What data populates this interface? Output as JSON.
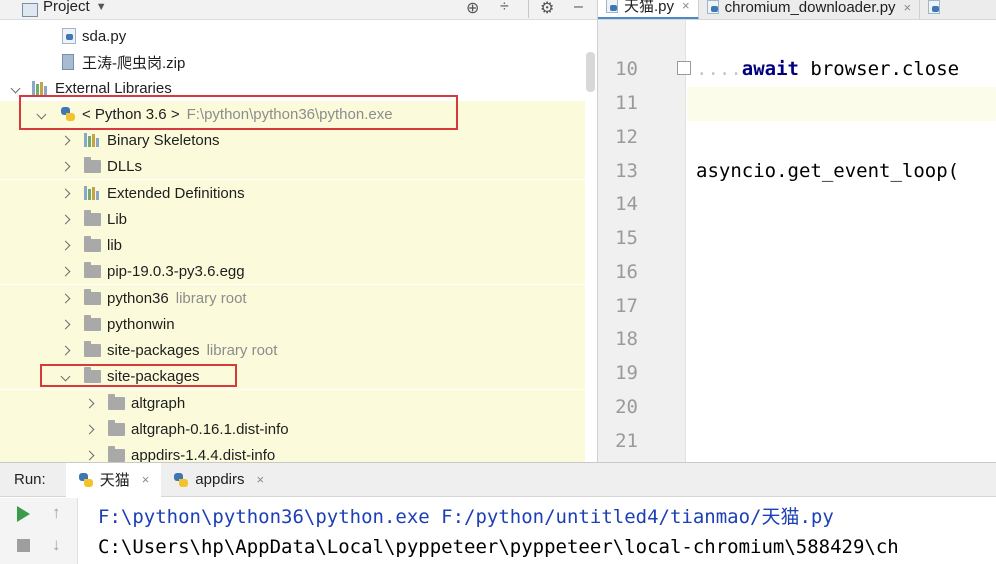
{
  "project": {
    "title": "Project",
    "items": [
      {
        "label": "sda.py",
        "hint": ""
      },
      {
        "label": "王涛-爬虫岗.zip",
        "hint": ""
      },
      {
        "label": "External Libraries",
        "hint": ""
      },
      {
        "label": "< Python 3.6 >",
        "hint": "F:\\python\\python36\\python.exe"
      },
      {
        "label": "Binary Skeletons",
        "hint": ""
      },
      {
        "label": "DLLs",
        "hint": ""
      },
      {
        "label": "Extended Definitions",
        "hint": ""
      },
      {
        "label": "Lib",
        "hint": ""
      },
      {
        "label": "lib",
        "hint": ""
      },
      {
        "label": "pip-19.0.3-py3.6.egg",
        "hint": ""
      },
      {
        "label": "python36",
        "hint": "library root"
      },
      {
        "label": "pythonwin",
        "hint": ""
      },
      {
        "label": "site-packages",
        "hint": "library root"
      },
      {
        "label": "site-packages",
        "hint": ""
      },
      {
        "label": "altgraph",
        "hint": ""
      },
      {
        "label": "altgraph-0.16.1.dist-info",
        "hint": ""
      },
      {
        "label": "appdirs-1.4.4.dist-info",
        "hint": ""
      }
    ]
  },
  "editor": {
    "tabs": [
      {
        "label": "天猫.py"
      },
      {
        "label": "chromium_downloader.py"
      }
    ],
    "line_numbers": [
      "10",
      "11",
      "12",
      "13",
      "14",
      "15",
      "16",
      "17",
      "18",
      "19",
      "20",
      "21"
    ],
    "code": {
      "line10_dots": "....",
      "line10_kw": "await",
      "line10_rest": " browser.close",
      "line13": "asyncio.get_event_loop("
    }
  },
  "run": {
    "title": "Run:",
    "tabs": [
      {
        "label": "天猫"
      },
      {
        "label": "appdirs"
      }
    ],
    "console": [
      "F:\\python\\python36\\python.exe F:/python/untitled4/tianmao/天猫.py",
      "C:\\Users\\hp\\AppData\\Local\\pyppeteer\\pyppeteer\\local-chromium\\588429\\ch"
    ]
  },
  "icons": {
    "tab_close": "×",
    "run_up": "↑",
    "run_down": "↓",
    "header_target": "⊕",
    "header_collapse": "÷",
    "header_gear": "⚙"
  },
  "colors": {
    "highlight_row": "#fbfbdc",
    "annotation_box": "#d63a3a",
    "keyword": "#000080",
    "console_cmd": "#1c3fb5"
  }
}
